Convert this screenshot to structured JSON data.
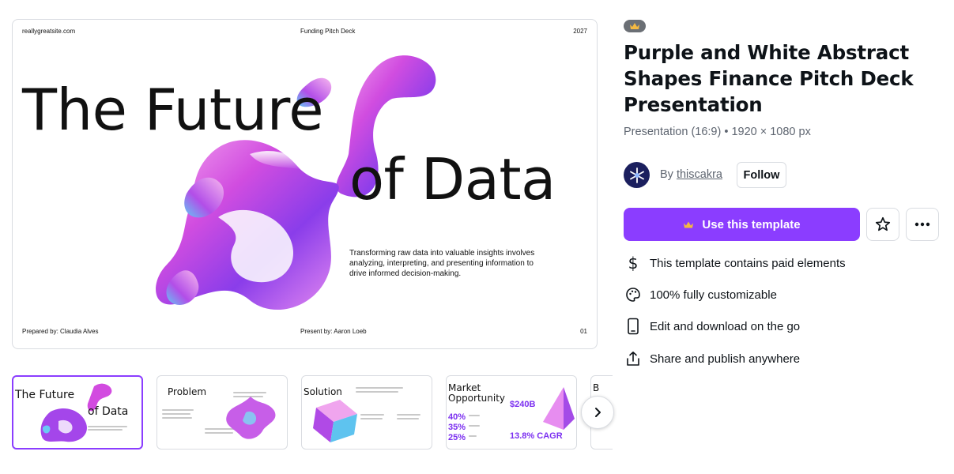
{
  "preview": {
    "site": "reallygreatsite.com",
    "deck_label": "Funding Pitch Deck",
    "year": "2027",
    "headline_line1": "The Future",
    "headline_line2": "of Data",
    "tagline": "Transforming raw data into valuable insights involves analyzing, interpreting, and presenting information to drive informed decision-making.",
    "prepared_by": "Prepared by: Claudia Alves",
    "present_by": "Present by: Aaron Loeb",
    "page_number": "01"
  },
  "thumbnails": [
    {
      "line1": "The Future",
      "line2": "of Data"
    },
    {
      "title": "Problem"
    },
    {
      "title": "Solution"
    },
    {
      "title": "Market Opportunity",
      "percents": [
        "40%",
        "35%",
        "25%"
      ],
      "big_value": "$240B",
      "cagr": "13.8% CAGR"
    },
    {
      "title": "B"
    }
  ],
  "template": {
    "title": "Purple and White Abstract Shapes Finance Pitch Deck Presentation",
    "meta": "Presentation (16:9) • 1920 × 1080 px",
    "by_prefix": "By",
    "author": "thiscakra",
    "follow_label": "Follow",
    "use_label": "Use this template",
    "features": [
      {
        "icon": "dollar-icon",
        "label": "This template contains paid elements"
      },
      {
        "icon": "palette-icon",
        "label": "100% fully customizable"
      },
      {
        "icon": "mobile-icon",
        "label": "Edit and download on the go"
      },
      {
        "icon": "share-icon",
        "label": "Share and publish anywhere"
      }
    ]
  },
  "colors": {
    "accent": "#8b3dff",
    "text": "#0e1318",
    "muted": "#5e6570"
  }
}
